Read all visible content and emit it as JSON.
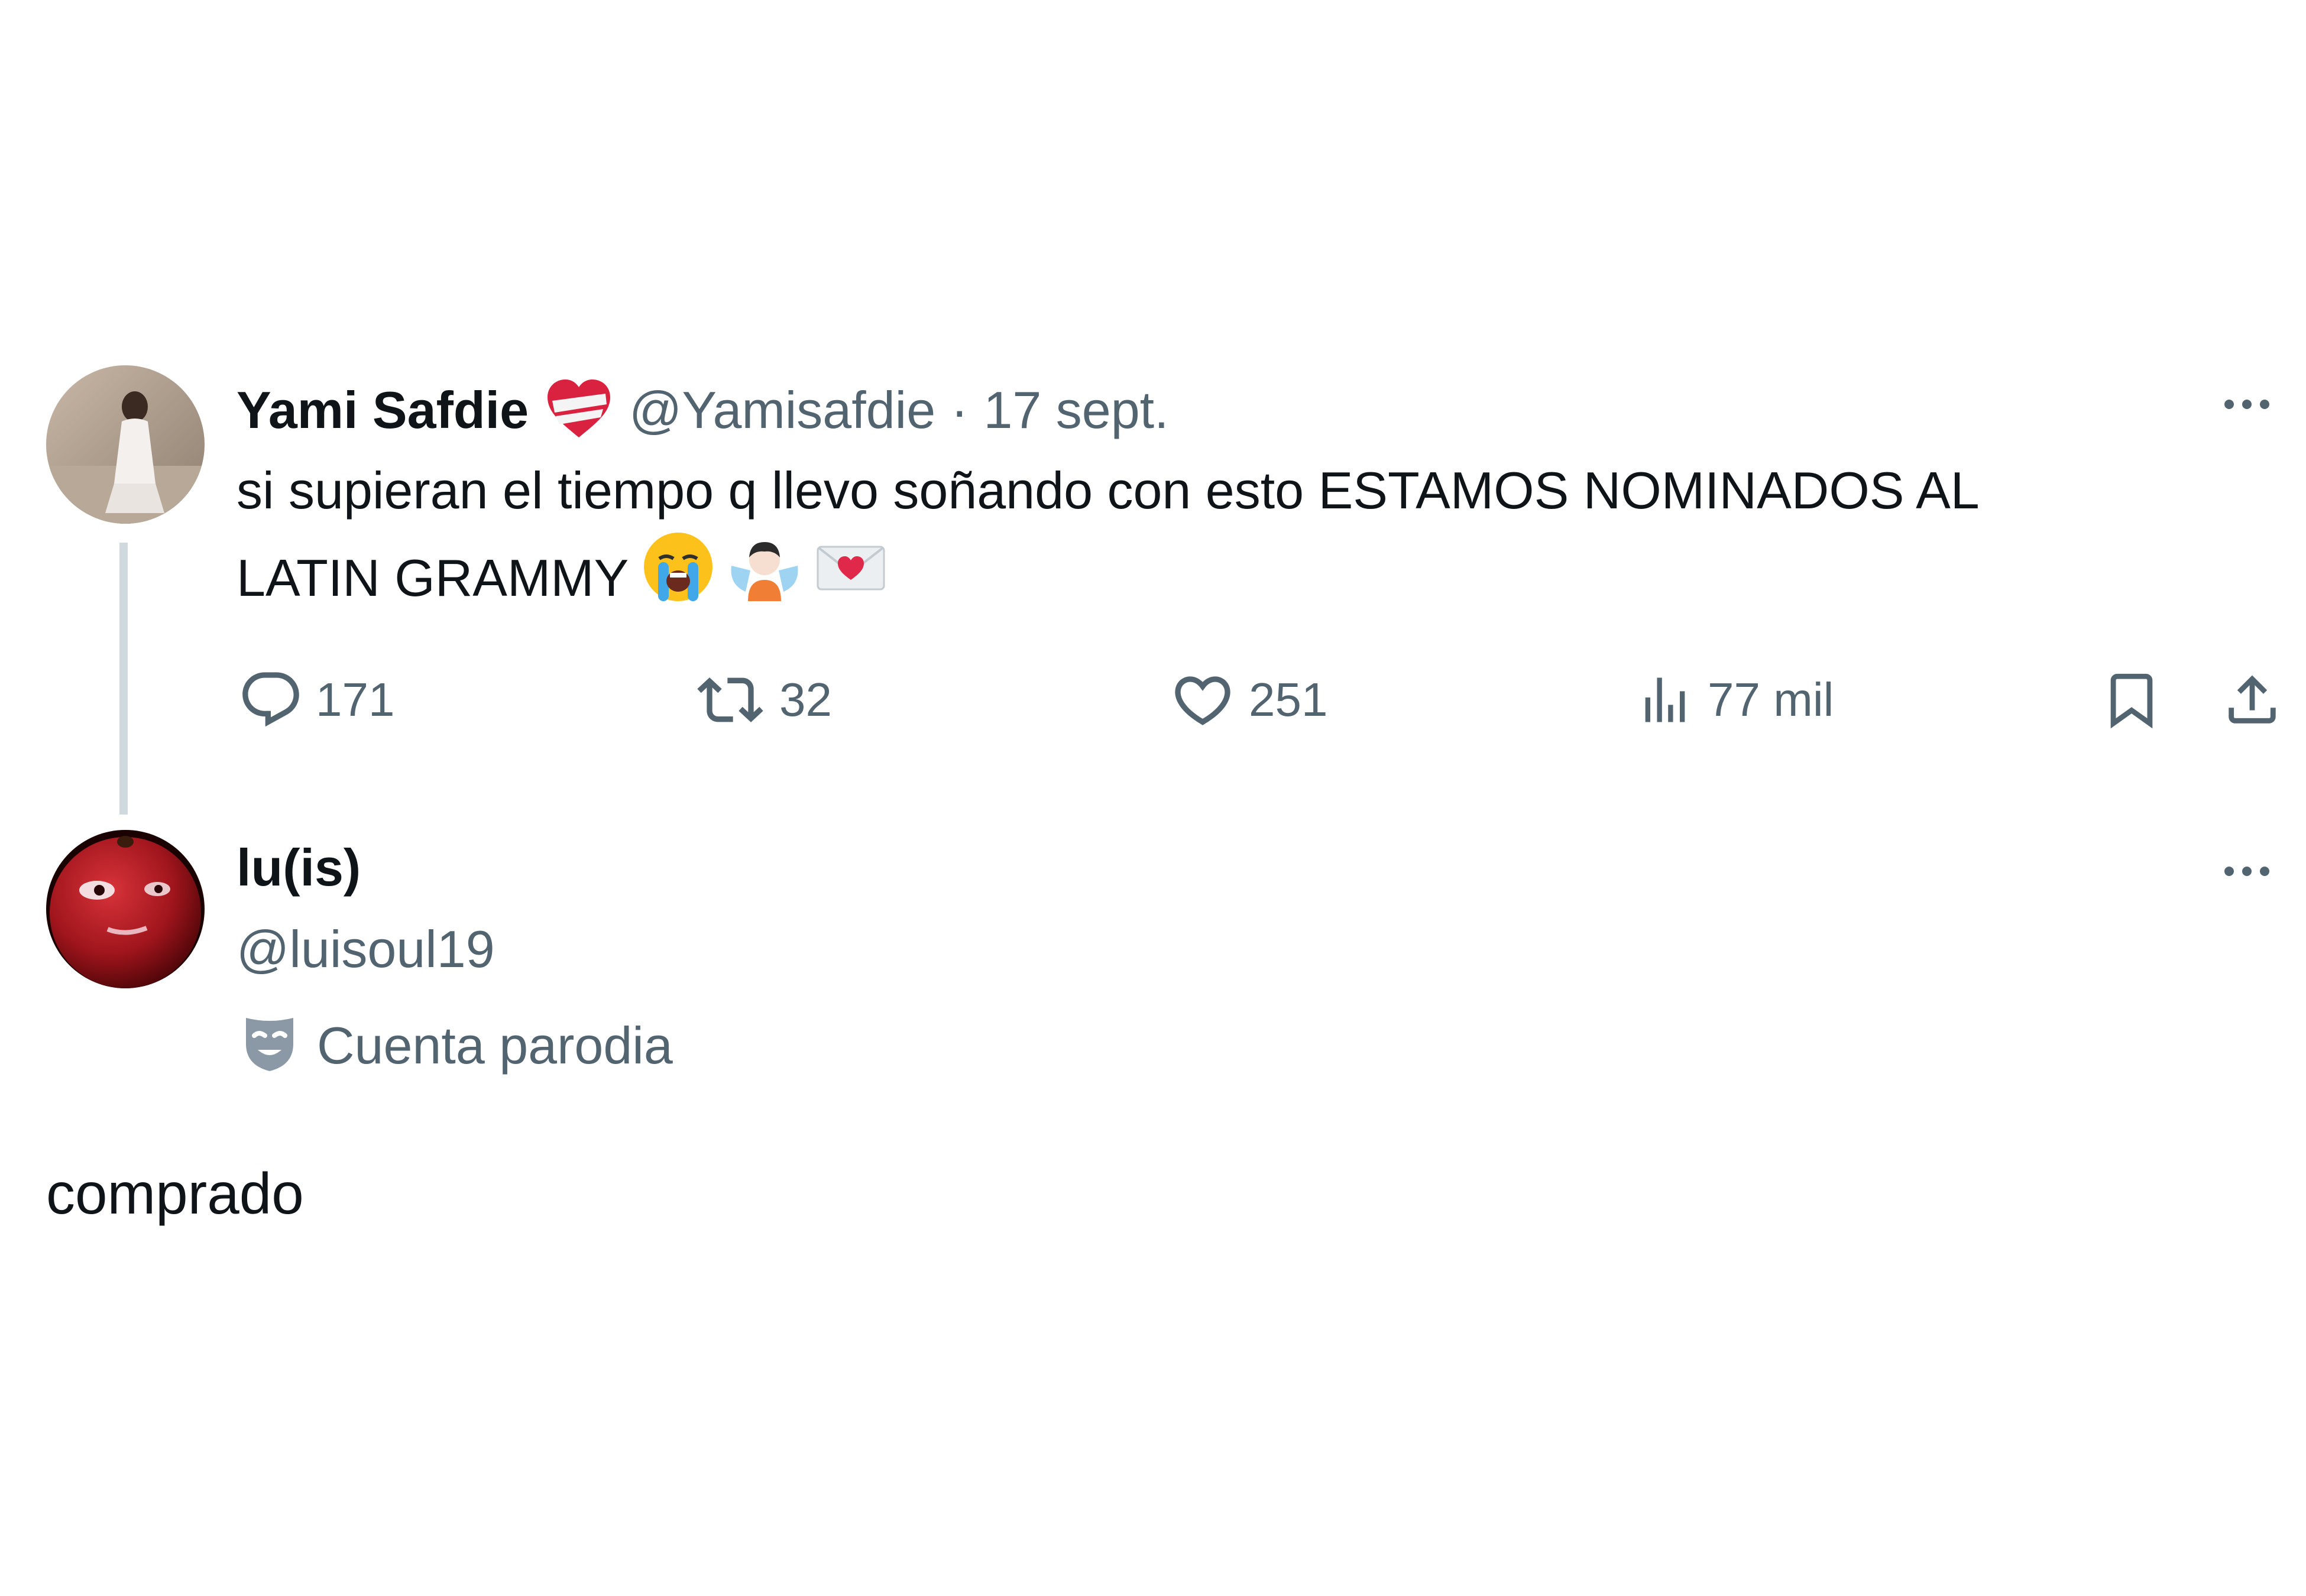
{
  "tweet": {
    "author_name": "Yami Safdie",
    "handle": "@Yamisafdie",
    "separator": "·",
    "date": "17 sept.",
    "badge_icon": "heart-ribbon-emoji",
    "text_line1": "si supieran el tiempo q llevo soñando con esto ESTAMOS NOMINADOS AL",
    "text_line2": "LATIN GRAMMY",
    "emojis": [
      "loudly-crying-face",
      "person-with-angel-wings",
      "love-letter"
    ],
    "actions": {
      "replies": "171",
      "reposts": "32",
      "likes": "251",
      "views": "77 mil"
    }
  },
  "reply": {
    "author_name": "lu(is)",
    "handle": "@luisoul19",
    "label": "Cuenta parodia",
    "label_icon": "theater-masks-icon",
    "text": "comprado"
  },
  "colors": {
    "text": "#0f1419",
    "muted": "#536471",
    "thread_line": "#cfd9de"
  }
}
